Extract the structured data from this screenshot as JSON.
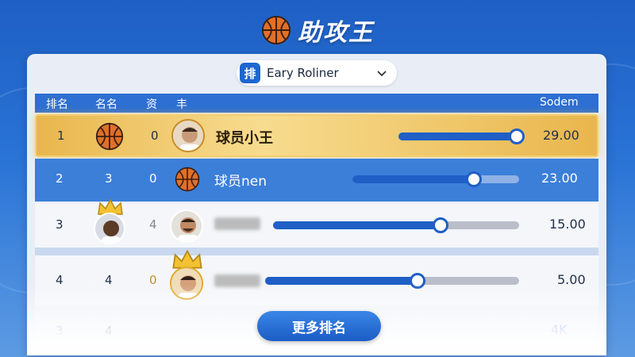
{
  "header": {
    "title": "助攻王",
    "icon": "basketball-icon"
  },
  "selector": {
    "badge": "排",
    "value": "Eary Roliner"
  },
  "table": {
    "columns": {
      "rank": "排名",
      "name": "名名",
      "stat": "资",
      "player": "丰",
      "score": "Sodem"
    },
    "rows": [
      {
        "rank": "1",
        "col2": "",
        "col3": "0",
        "name": "球员小王",
        "score": "29.00",
        "progress": 0.97
      },
      {
        "rank": "2",
        "col2": "3",
        "col3": "0",
        "name": "球员nen",
        "score": "23.00",
        "progress": 0.73
      },
      {
        "rank": "3",
        "col2": "",
        "col3": "4",
        "name": "",
        "score": "15.00",
        "progress": 0.68
      },
      {
        "rank": "4",
        "col2": "4",
        "col3": "0",
        "name": "",
        "score": "5.00",
        "progress": 0.6
      },
      {
        "rank": "3",
        "col2": "4",
        "col3": "",
        "name": "",
        "score": "4K",
        "progress": 0
      }
    ]
  },
  "footer": {
    "more_label": "更多排名"
  },
  "colors": {
    "primary": "#1f66d1",
    "gold": "#e9b64d"
  }
}
